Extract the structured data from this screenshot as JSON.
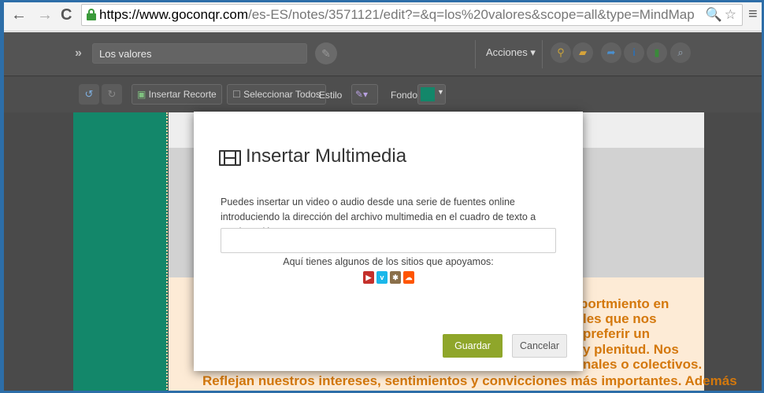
{
  "browser": {
    "url_host": "https://www.goconqr.com",
    "url_path": "/es-ES/notes/3571121/edit?=&q=los%20valores&scope=all&type=MindMap",
    "back_icon": "←",
    "forward_icon": "→",
    "reload_icon": "C",
    "zoom_star_icons": "🔍☆",
    "menu_icon": "≡"
  },
  "toolbar": {
    "title_value": "Los valores",
    "acciones_label": "Acciones ▾"
  },
  "toolbar2": {
    "insert_clip_label": "Insertar Recorte",
    "select_all_label": "Seleccionar Todos",
    "style_label": "Estilo",
    "background_label": "Fondo",
    "background_color": "#13876a"
  },
  "note_text": {
    "line1": "portmiento en",
    "line2": "les que nos",
    "line3": "preferir un",
    "line4": "y plenitud. Nos",
    "line5": "nales o colectivos.",
    "line6": "Reflejan nuestros intereses, sentimientos y convicciones más importantes. Además"
  },
  "modal": {
    "title": "Insertar Multimedia",
    "description": "Puedes insertar un video o audio desde una serie de fuentes online introduciendo la dirección del archivo multimedia en el cuadro de texto a continuación.",
    "input_value": "",
    "supported_text": "Aquí tienes algunos de los sitios que apoyamos:",
    "sites": [
      "youtube-icon",
      "vimeo-icon",
      "misc-icon",
      "soundcloud-icon"
    ],
    "save_label": "Guardar",
    "cancel_label": "Cancelar"
  },
  "colors": {
    "accent_green": "#8fa62a",
    "strip_green": "#13876a",
    "note_orange": "#d4780c"
  }
}
